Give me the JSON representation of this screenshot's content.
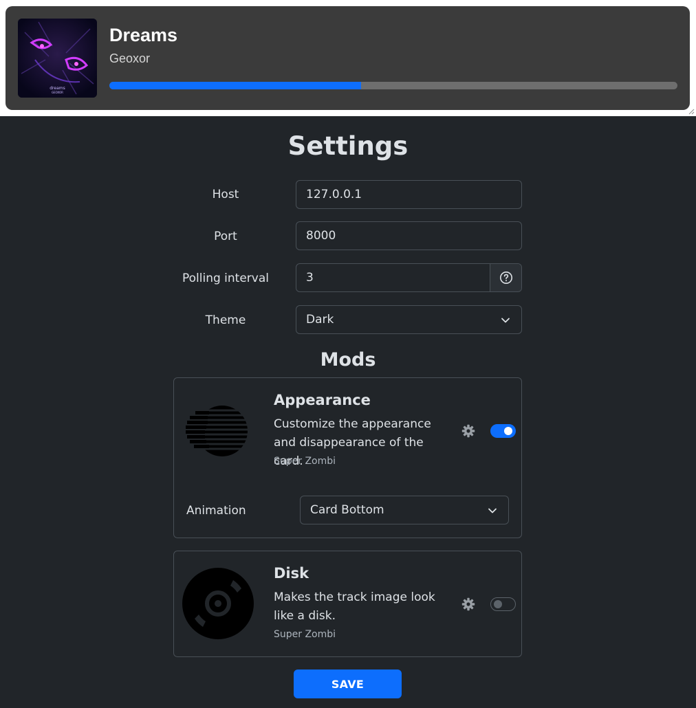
{
  "now_playing": {
    "title": "Dreams",
    "artist": "Geoxor",
    "progress_fraction": 0.443,
    "art_caption": "dreams",
    "art_sub": "GEOXOR"
  },
  "settings": {
    "heading": "Settings",
    "host": {
      "label": "Host",
      "value": "127.0.0.1"
    },
    "port": {
      "label": "Port",
      "value": "8000"
    },
    "polling": {
      "label": "Polling interval",
      "value": "3",
      "help_icon": "question-circle-icon"
    },
    "theme": {
      "label": "Theme",
      "value": "Dark"
    }
  },
  "mods": {
    "heading": "Mods",
    "appearance": {
      "name": "Appearance",
      "description": "Customize the appearance and disappearance of the card.",
      "author": "Super Zombi",
      "enabled": true,
      "animation_label": "Animation",
      "animation_value": "Card Bottom"
    },
    "disk": {
      "name": "Disk",
      "description": "Makes the track image look like a disk.",
      "author": "Super Zombi",
      "enabled": false
    }
  },
  "save_label": "SAVE",
  "colors": {
    "accent": "#0d6efd",
    "panel_bg": "#212529",
    "card_bg": "#3b3b3b",
    "border": "#495057"
  }
}
